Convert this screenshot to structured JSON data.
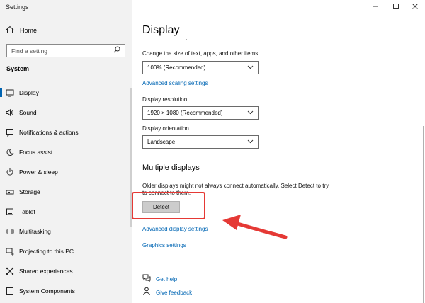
{
  "window": {
    "title": "Settings",
    "controls": [
      "minimize-icon",
      "maximize-icon",
      "close-icon"
    ]
  },
  "sidebar": {
    "home_label": "Home",
    "search_placeholder": "Find a setting",
    "section": "System",
    "items": [
      {
        "label": "Display",
        "icon": "monitor-icon",
        "active": true
      },
      {
        "label": "Sound",
        "icon": "speaker-icon"
      },
      {
        "label": "Notifications & actions",
        "icon": "notification-icon"
      },
      {
        "label": "Focus assist",
        "icon": "moon-icon"
      },
      {
        "label": "Power & sleep",
        "icon": "power-icon"
      },
      {
        "label": "Storage",
        "icon": "storage-icon"
      },
      {
        "label": "Tablet",
        "icon": "tablet-icon"
      },
      {
        "label": "Multitasking",
        "icon": "multitasking-icon"
      },
      {
        "label": "Projecting to this PC",
        "icon": "projecting-icon"
      },
      {
        "label": "Shared experiences",
        "icon": "shared-icon"
      },
      {
        "label": "System Components",
        "icon": "components-icon"
      }
    ]
  },
  "main": {
    "title": "Display",
    "scale": {
      "label": "Change the size of text, apps, and other items",
      "value": "100% (Recommended)",
      "link": "Advanced scaling settings"
    },
    "resolution": {
      "label": "Display resolution",
      "value": "1920 × 1080 (Recommended)"
    },
    "orientation": {
      "label": "Display orientation",
      "value": "Landscape"
    },
    "multiple": {
      "heading": "Multiple displays",
      "text": "Older displays might not always connect automatically. Select Detect to try to connect to them.",
      "detect_label": "Detect"
    },
    "advanced_display_link": "Advanced display settings",
    "graphics_link": "Graphics settings",
    "get_help": "Get help",
    "give_feedback": "Give feedback"
  },
  "colors": {
    "accent": "#0066b4",
    "highlight": "#e53935"
  }
}
